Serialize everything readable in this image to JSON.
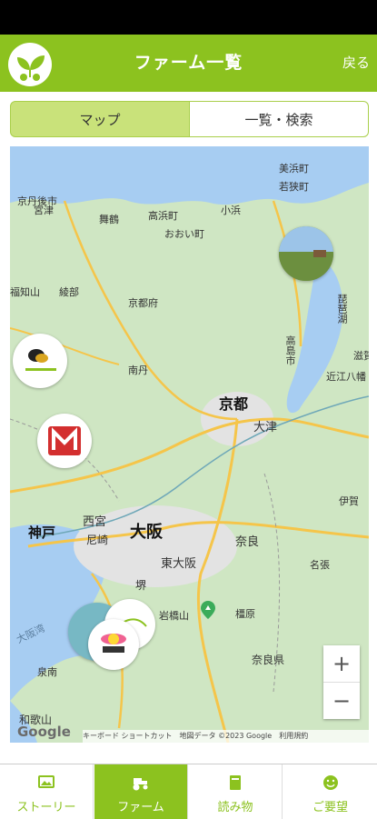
{
  "header": {
    "title": "ファーム一覧",
    "back_label": "戻る",
    "logo_text": "Y F"
  },
  "tabs": {
    "map": "マップ",
    "list": "一覧・検索"
  },
  "map": {
    "labels": {
      "tango": "京丹後市",
      "miyazu": "宮津",
      "maizuru": "舞鶴",
      "takahama": "高浜町",
      "ohi": "おおい町",
      "obama": "小浜",
      "mihama": "美浜町",
      "wakasa": "若狭町",
      "fukuchiyama": "福知山",
      "ayabe": "綾部",
      "kyotofu": "京都府",
      "nantan": "南丹",
      "takashima": "高島市",
      "biwako": "琵琶湖",
      "kyoto": "京都",
      "otsu": "大津",
      "kobe": "神戸",
      "nishinomiya": "西宮",
      "amagasaki": "尼崎",
      "osaka": "大阪",
      "higashiosaka": "東大阪",
      "sakai": "堺",
      "nara": "奈良",
      "ikoma": "岩橋山",
      "kashihara": "橿原",
      "narapref": "奈良県",
      "nabari": "名張",
      "iga": "伊賀",
      "izumi": "泉南",
      "wakayama": "和歌山",
      "osakawan": "大阪湾",
      "konan": "近江八幡",
      "shiga": "滋賀"
    },
    "zoom_in": "+",
    "zoom_out": "−",
    "credits": "キーボード ショートカット　地図データ ©2023 Google　利用規約",
    "google": "Google"
  },
  "nav": [
    {
      "label": "ストーリー"
    },
    {
      "label": "ファーム"
    },
    {
      "label": "読み物"
    },
    {
      "label": "ご要望"
    }
  ],
  "colors": {
    "brand": "#8cc21f",
    "tab_active": "#c9e27a",
    "water": "#a7cdf2",
    "land": "#cfe6c3"
  }
}
